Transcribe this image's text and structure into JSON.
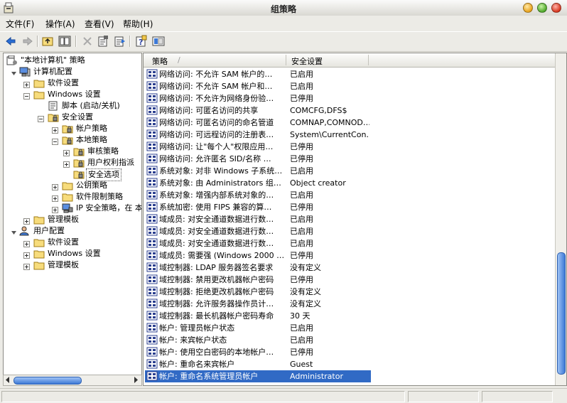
{
  "window": {
    "title": "组策略"
  },
  "menubar": [
    {
      "label": "文件(F)"
    },
    {
      "label": "操作(A)"
    },
    {
      "label": "查看(V)"
    },
    {
      "label": "帮助(H)"
    }
  ],
  "toolbar": [
    "back-icon",
    "forward-icon",
    "up-folder-icon",
    "show-tree-icon",
    "delete-icon",
    "properties-icon",
    "export-icon",
    "help-icon",
    "view-icon"
  ],
  "tree": [
    {
      "label": "\"本地计算机\" 策略",
      "icon": "policy-icon",
      "expander": "none"
    },
    {
      "label": "计算机配置",
      "icon": "computer-icon",
      "expander": "open"
    },
    {
      "label": "软件设置",
      "icon": "folder-icon",
      "expander": "plus"
    },
    {
      "label": "Windows 设置",
      "icon": "folder-icon",
      "expander": "minus"
    },
    {
      "label": "脚本 (启动/关机)",
      "icon": "script-icon",
      "expander": "none"
    },
    {
      "label": "安全设置",
      "icon": "security-folder-icon",
      "expander": "minus"
    },
    {
      "label": "帐户策略",
      "icon": "security-folder-icon",
      "expander": "plus"
    },
    {
      "label": "本地策略",
      "icon": "security-folder-icon",
      "expander": "minus"
    },
    {
      "label": "审核策略",
      "icon": "security-folder-icon",
      "expander": "plus"
    },
    {
      "label": "用户权利指派",
      "icon": "security-folder-icon",
      "expander": "plus"
    },
    {
      "label": "安全选项",
      "icon": "security-folder-icon",
      "expander": "none",
      "selected": true
    },
    {
      "label": "公钥策略",
      "icon": "folder-icon",
      "expander": "plus"
    },
    {
      "label": "软件限制策略",
      "icon": "folder-icon",
      "expander": "plus"
    },
    {
      "label": "IP 安全策略，在 本",
      "icon": "ipsec-icon",
      "expander": "plus"
    },
    {
      "label": "管理模板",
      "icon": "folder-icon",
      "expander": "plus"
    },
    {
      "label": "用户配置",
      "icon": "user-icon",
      "expander": "open"
    },
    {
      "label": "软件设置",
      "icon": "folder-icon",
      "expander": "plus"
    },
    {
      "label": "Windows 设置",
      "icon": "folder-icon",
      "expander": "plus"
    },
    {
      "label": "管理模板",
      "icon": "folder-icon",
      "expander": "plus"
    }
  ],
  "list": {
    "columns": [
      "策略",
      "安全设置"
    ],
    "sort_indicator": "/",
    "rows": [
      {
        "policy": "网络访问: 不允许 SAM 帐户的…",
        "setting": "已启用"
      },
      {
        "policy": "网络访问: 不允许 SAM 帐户和…",
        "setting": "已启用"
      },
      {
        "policy": "网络访问: 不允许为网络身份验…",
        "setting": "已停用"
      },
      {
        "policy": "网络访问: 可匿名访问的共享",
        "setting": "COMCFG,DFS$"
      },
      {
        "policy": "网络访问: 可匿名访问的命名管道",
        "setting": "COMNAP,COMNOD…"
      },
      {
        "policy": "网络访问: 可远程访问的注册表…",
        "setting": "System\\CurrentCon…"
      },
      {
        "policy": "网络访问: 让\"每个人\"权限应用…",
        "setting": "已停用"
      },
      {
        "policy": "网络访问: 允许匿名 SID/名称 …",
        "setting": "已停用"
      },
      {
        "policy": "系统对象: 对非 Windows 子系统…",
        "setting": "已启用"
      },
      {
        "policy": "系统对象: 由 Administrators 组…",
        "setting": "Object creator"
      },
      {
        "policy": "系统对象: 增强内部系统对象的…",
        "setting": "已启用"
      },
      {
        "policy": "系统加密: 使用 FIPS 兼容的算…",
        "setting": "已停用"
      },
      {
        "policy": "域成员: 对安全通道数据进行数…",
        "setting": "已启用"
      },
      {
        "policy": "域成员: 对安全通道数据进行数…",
        "setting": "已启用"
      },
      {
        "policy": "域成员: 对安全通道数据进行数…",
        "setting": "已启用"
      },
      {
        "policy": "域成员: 需要强 (Windows 2000 …",
        "setting": "已停用"
      },
      {
        "policy": "域控制器: LDAP 服务器签名要求",
        "setting": "没有定义"
      },
      {
        "policy": "域控制器: 禁用更改机器帐户密码",
        "setting": "已停用"
      },
      {
        "policy": "域控制器: 拒绝更改机器帐户密码",
        "setting": "没有定义"
      },
      {
        "policy": "域控制器: 允许服务器操作员计…",
        "setting": "没有定义"
      },
      {
        "policy": "域控制器: 最长机器帐户密码寿命",
        "setting": "30 天"
      },
      {
        "policy": "帐户: 管理员帐户状态",
        "setting": "已启用"
      },
      {
        "policy": "帐户: 来宾帐户状态",
        "setting": "已启用"
      },
      {
        "policy": "帐户: 使用空白密码的本地帐户…",
        "setting": "已停用"
      },
      {
        "policy": "帐户: 重命名来宾帐户",
        "setting": "Guest"
      },
      {
        "policy": "帐户: 重命名系统管理员帐户",
        "setting": "Administrator",
        "selected": true
      }
    ]
  },
  "colors": {
    "selection": "#316ac5",
    "window_bg": "#ecebe6"
  }
}
